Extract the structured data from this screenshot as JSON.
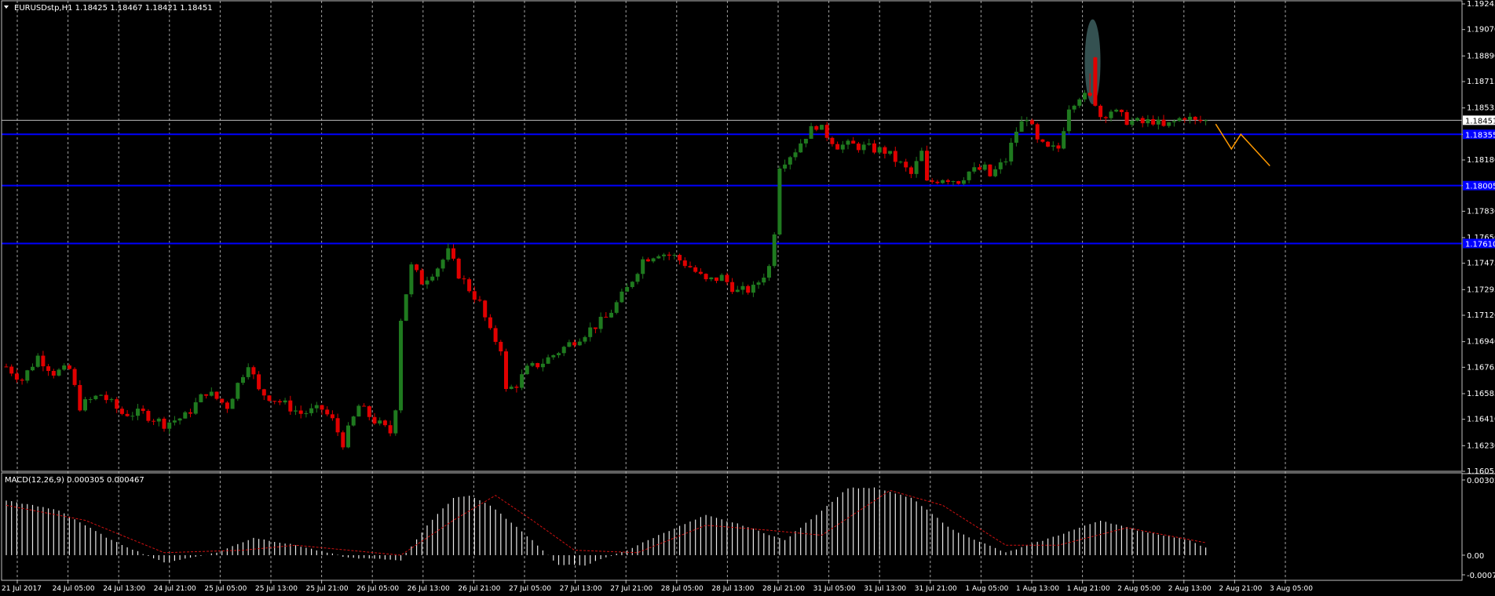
{
  "window": {
    "symbol_line": "EURUSDstp,H1  1.18425 1.18467 1.18421 1.18451",
    "macd_line": "MACD(12,26,9) 0.000305 0.000467"
  },
  "colors": {
    "background": "#000000",
    "bull": "#1f7a1f",
    "bear": "#e00000",
    "grid": "#c0c0c0",
    "level_line": "#0000ff",
    "signal": "#d01010",
    "forecast": "#ff9900",
    "highlight": "#3a5a5a"
  },
  "chart_data": [
    {
      "type": "candlestick",
      "name": "EURUSDstp,H1",
      "ylim": [
        1.16055,
        1.19245
      ],
      "y_ticks": [
        "1.19245",
        "1.19070",
        "1.18890",
        "1.18715",
        "1.18535",
        "1.18355",
        "1.18180",
        "1.18005",
        "1.17830",
        "1.17650",
        "1.17475",
        "1.17295",
        "1.17120",
        "1.16940",
        "1.16765",
        "1.16585",
        "1.16410",
        "1.16230",
        "1.16055"
      ],
      "current_price": "1.18451",
      "horizontal_levels": [
        {
          "price": 1.18355,
          "label": "1.18355"
        },
        {
          "price": 1.18005,
          "label": "1.18005"
        },
        {
          "price": 1.1761,
          "label": "1.17610"
        }
      ],
      "grid": true,
      "x_ticks": [
        "21 Jul 2017",
        "24 Jul 05:00",
        "24 Jul 13:00",
        "24 Jul 21:00",
        "25 Jul 05:00",
        "25 Jul 13:00",
        "25 Jul 21:00",
        "26 Jul 05:00",
        "26 Jul 13:00",
        "26 Jul 21:00",
        "27 Jul 05:00",
        "27 Jul 13:00",
        "27 Jul 21:00",
        "28 Jul 05:00",
        "28 Jul 13:00",
        "28 Jul 21:00",
        "31 Jul 05:00",
        "31 Jul 13:00",
        "31 Jul 21:00",
        "1 Aug 05:00",
        "1 Aug 13:00",
        "1 Aug 21:00",
        "2 Aug 05:00",
        "2 Aug 13:00",
        "2 Aug 21:00",
        "3 Aug 05:00"
      ],
      "anchors": [
        [
          0,
          1.1677
        ],
        [
          3,
          1.1668
        ],
        [
          6,
          1.1684
        ],
        [
          9,
          1.1673
        ],
        [
          12,
          1.1675
        ],
        [
          14,
          1.165
        ],
        [
          18,
          1.1658
        ],
        [
          22,
          1.1645
        ],
        [
          26,
          1.1645
        ],
        [
          30,
          1.1638
        ],
        [
          34,
          1.1643
        ],
        [
          38,
          1.166
        ],
        [
          42,
          1.165
        ],
        [
          46,
          1.168
        ],
        [
          47,
          1.167
        ],
        [
          48,
          1.166
        ],
        [
          52,
          1.1653
        ],
        [
          56,
          1.1645
        ],
        [
          60,
          1.1648
        ],
        [
          62,
          1.164
        ],
        [
          64,
          1.1625
        ],
        [
          67,
          1.165
        ],
        [
          70,
          1.164
        ],
        [
          73,
          1.1632
        ],
        [
          74,
          1.165
        ],
        [
          75,
          1.171
        ],
        [
          77,
          1.1745
        ],
        [
          79,
          1.1735
        ],
        [
          82,
          1.1745
        ],
        [
          84,
          1.1755
        ],
        [
          86,
          1.174
        ],
        [
          90,
          1.172
        ],
        [
          92,
          1.17
        ],
        [
          94,
          1.169
        ],
        [
          95,
          1.166
        ],
        [
          97,
          1.1665
        ],
        [
          99,
          1.1675
        ],
        [
          102,
          1.168
        ],
        [
          106,
          1.169
        ],
        [
          110,
          1.17
        ],
        [
          114,
          1.171
        ],
        [
          118,
          1.173
        ],
        [
          121,
          1.175
        ],
        [
          124,
          1.1755
        ],
        [
          127,
          1.1752
        ],
        [
          130,
          1.1745
        ],
        [
          133,
          1.1735
        ],
        [
          136,
          1.1738
        ],
        [
          139,
          1.1728
        ],
        [
          142,
          1.173
        ],
        [
          145,
          1.1745
        ],
        [
          146,
          1.177
        ],
        [
          147,
          1.1815
        ],
        [
          150,
          1.1825
        ],
        [
          152,
          1.1835
        ],
        [
          154,
          1.1842
        ],
        [
          156,
          1.1835
        ],
        [
          158,
          1.1828
        ],
        [
          161,
          1.1828
        ],
        [
          164,
          1.1826
        ],
        [
          167,
          1.1824
        ],
        [
          170,
          1.1815
        ],
        [
          172,
          1.1808
        ],
        [
          174,
          1.1823
        ],
        [
          175,
          1.1802
        ],
        [
          178,
          1.1806
        ],
        [
          181,
          1.1804
        ],
        [
          183,
          1.181
        ],
        [
          186,
          1.1812
        ],
        [
          187,
          1.1807
        ],
        [
          190,
          1.1818
        ],
        [
          192,
          1.1838
        ],
        [
          194,
          1.1848
        ],
        [
          196,
          1.183
        ],
        [
          198,
          1.1825
        ],
        [
          200,
          1.1826
        ],
        [
          202,
          1.1855
        ],
        [
          204,
          1.1862
        ],
        [
          206,
          1.186
        ],
        [
          208,
          1.1848
        ],
        [
          210,
          1.1852
        ],
        [
          213,
          1.1845
        ],
        [
          216,
          1.1843
        ],
        [
          218,
          1.1845
        ],
        [
          220,
          1.184
        ],
        [
          224,
          1.1848
        ],
        [
          226,
          1.1844
        ],
        [
          228,
          1.18451
        ]
      ],
      "highlight_candle": 207,
      "forecast_path": [
        1.18425,
        1.18255,
        1.18355,
        1.1814
      ]
    },
    {
      "type": "histogram",
      "name": "MACD(12,26,9)",
      "ylim": [
        -0.000789,
        0.00302
      ],
      "y_ticks": [
        "0.00302",
        "0.00",
        "-0.000789"
      ],
      "macd_anchors": [
        [
          0,
          0.0022
        ],
        [
          10,
          0.0018
        ],
        [
          20,
          0.0006
        ],
        [
          30,
          -0.0003
        ],
        [
          40,
          0.0001
        ],
        [
          47,
          0.0007
        ],
        [
          55,
          0.0004
        ],
        [
          65,
          -0.0001
        ],
        [
          75,
          -0.0002
        ],
        [
          80,
          0.0012
        ],
        [
          85,
          0.0023
        ],
        [
          88,
          0.0024
        ],
        [
          92,
          0.002
        ],
        [
          100,
          0.0006
        ],
        [
          105,
          -0.0004
        ],
        [
          110,
          -0.0004
        ],
        [
          118,
          0.0002
        ],
        [
          125,
          0.0009
        ],
        [
          133,
          0.0016
        ],
        [
          140,
          0.0012
        ],
        [
          148,
          0.0006
        ],
        [
          155,
          0.0018
        ],
        [
          160,
          0.0027
        ],
        [
          165,
          0.0027
        ],
        [
          172,
          0.0023
        ],
        [
          180,
          0.001
        ],
        [
          190,
          0.0001
        ],
        [
          200,
          0.0008
        ],
        [
          208,
          0.0014
        ],
        [
          215,
          0.001
        ],
        [
          225,
          0.0006
        ],
        [
          228,
          0.0003
        ]
      ],
      "signal_anchors": [
        [
          0,
          0.002
        ],
        [
          15,
          0.0014
        ],
        [
          30,
          0.0001
        ],
        [
          45,
          0.0002
        ],
        [
          55,
          0.0004
        ],
        [
          65,
          0.0002
        ],
        [
          75,
          0.0
        ],
        [
          85,
          0.0014
        ],
        [
          93,
          0.0024
        ],
        [
          100,
          0.0014
        ],
        [
          108,
          0.0002
        ],
        [
          120,
          0.0001
        ],
        [
          133,
          0.0012
        ],
        [
          145,
          0.001
        ],
        [
          155,
          0.0008
        ],
        [
          168,
          0.0026
        ],
        [
          178,
          0.002
        ],
        [
          190,
          0.0004
        ],
        [
          200,
          0.0004
        ],
        [
          213,
          0.0011
        ],
        [
          228,
          0.0005
        ]
      ]
    }
  ]
}
